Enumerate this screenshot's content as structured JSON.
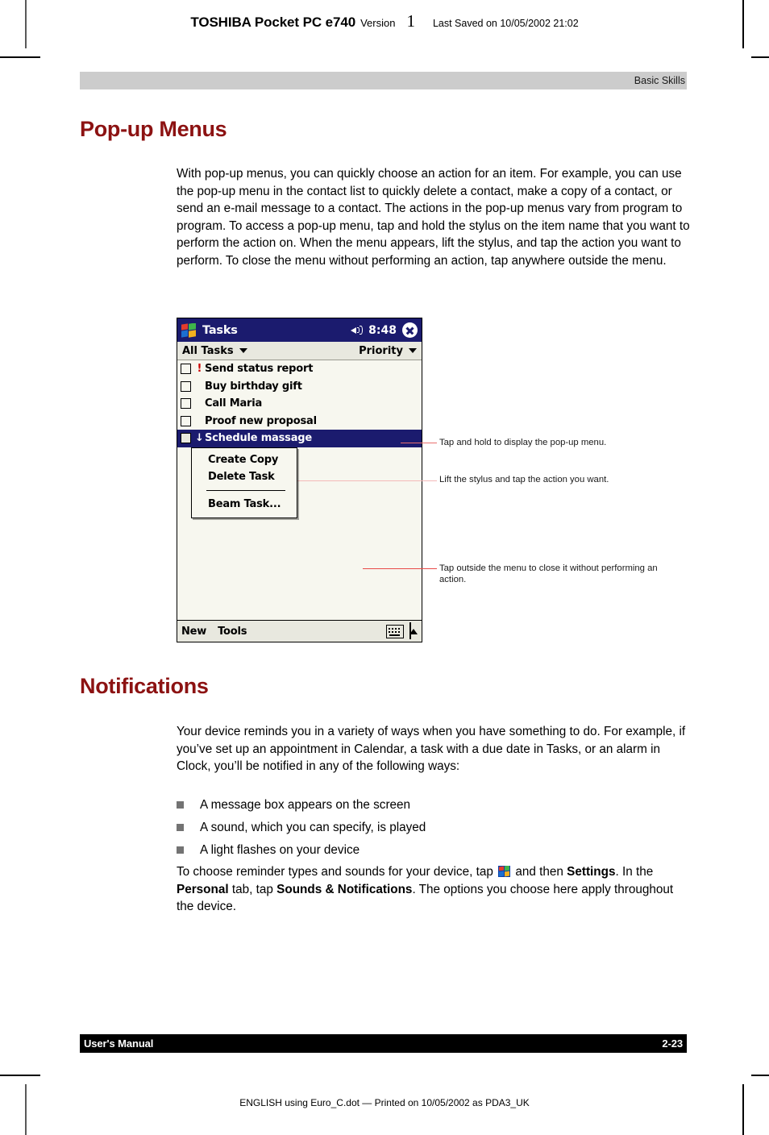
{
  "page": {
    "header": {
      "brand": "TOSHIBA Pocket PC e740",
      "version_label": "Version",
      "version_number": "1",
      "last_saved": "Last Saved on 10/05/2002 21:02"
    },
    "running_head": "Basic Skills",
    "footer": {
      "left": "User's Manual",
      "right": "2-23"
    },
    "print_line": "ENGLISH using  Euro_C.dot — Printed on 10/05/2002 as PDA3_UK"
  },
  "sections": {
    "popup_menus": {
      "heading": "Pop-up Menus",
      "paragraph": "With pop-up menus, you can quickly choose an action for an item. For example, you can use the pop-up menu in the contact list to quickly delete a contact, make a copy of a contact, or send an e-mail message to a contact. The actions in the pop-up menus vary from program to program. To access a pop-up menu, tap and hold the stylus on the item name that you want to perform the action on. When the menu appears, lift the stylus, and tap the action you want to perform. To close the menu without performing an action, tap anywhere outside the menu."
    },
    "notifications": {
      "heading": "Notifications",
      "paragraph": "Your device reminds you in a variety of ways when you have something to do. For example, if you’ve set up an appointment in Calendar, a task with a due date in Tasks, or an alarm in Clock, you’ll be notified in any of the following ways:",
      "bullets": [
        "A message box appears on the screen",
        "A sound, which you can specify, is played",
        "A light flashes on your device"
      ],
      "closing": {
        "part1": "To choose reminder types and sounds for your device, tap ",
        "part2": " and then ",
        "bold1": "Settings",
        "part3": ". In the ",
        "bold2": "Personal",
        "part4": " tab, tap ",
        "bold3": "Sounds & Notifications",
        "part5": ". The options you choose here apply throughout the device."
      }
    }
  },
  "figure": {
    "device_screen": {
      "title": "Tasks",
      "clock": "8:48",
      "filter_left": "All Tasks",
      "filter_right": "Priority",
      "tasks": [
        {
          "name": "Send status report",
          "priority": "!",
          "selected": false
        },
        {
          "name": "Buy birthday gift",
          "priority": "",
          "selected": false
        },
        {
          "name": "Call Maria",
          "priority": "",
          "selected": false
        },
        {
          "name": "Proof new proposal",
          "priority": "",
          "selected": false
        },
        {
          "name": "Schedule massage",
          "priority": "↓",
          "selected": true
        }
      ],
      "popup_menu": {
        "items": [
          "Create Copy",
          "Delete Task"
        ],
        "beam_item": "Beam Task..."
      },
      "bottom_bar": {
        "new": "New",
        "tools": "Tools"
      }
    },
    "callouts": [
      "Tap and hold to display the pop-up menu.",
      "Lift the stylus and tap the action you want.",
      "Tap outside the menu to close it without performing an action."
    ]
  },
  "colors": {
    "heading_red": "#8c1212",
    "runhead_gray": "#cccccc",
    "title_navy": "#1b1b6e",
    "bullet_gray": "#737373",
    "leader_red": "#e84a48"
  }
}
